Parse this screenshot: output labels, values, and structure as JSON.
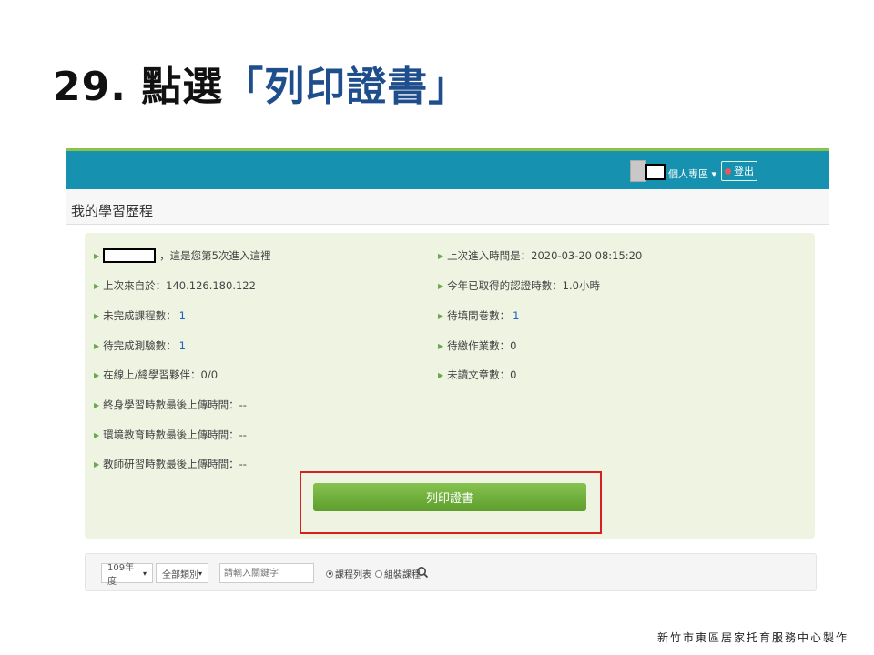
{
  "slide": {
    "title_prefix": "29. 點選",
    "title_highlight": "「列印證書」",
    "footer": "新竹市東區居家托育服務中心製作"
  },
  "app": {
    "header": {
      "profile_label": "個人專區",
      "logout_label": "登出"
    },
    "page_title": "我的學習歷程",
    "info": {
      "welcome": "，這是您第5次進入這裡",
      "last_login_time": "上次進入時間是：2020-03-20 08:15:20",
      "last_ip": "上次來自於：140.126.180.122",
      "hours_this_year": "今年已取得的認證時數：1.0小時",
      "unfinished_courses_label": "未完成課程數：",
      "unfinished_courses_value": "1",
      "pending_surveys_label": "待填問卷數：",
      "pending_surveys_value": "1",
      "pending_tests_label": "待完成測驗數：",
      "pending_tests_value": "1",
      "pending_homework": "待繳作業數：0",
      "online_peers": "在線上/總學習夥伴：0/0",
      "unread_articles": "未讀文章數：0",
      "lifelong_upload": "終身學習時數最後上傳時間：--",
      "env_upload": "環境教育時數最後上傳時間：--",
      "teacher_upload": "教師研習時數最後上傳時間：--"
    },
    "print_button": "列印證書",
    "filter": {
      "year": "109年度",
      "category": "全部類別",
      "keyword_placeholder": "請輸入關鍵字",
      "radio_course_list": "課程列表",
      "radio_group_course": "組裝課程"
    }
  },
  "colors": {
    "topbar": "#1692b0",
    "print_button": "#6aaf3a",
    "highlight_box": "#d81f1f",
    "title_highlight": "#1f4e8c"
  }
}
